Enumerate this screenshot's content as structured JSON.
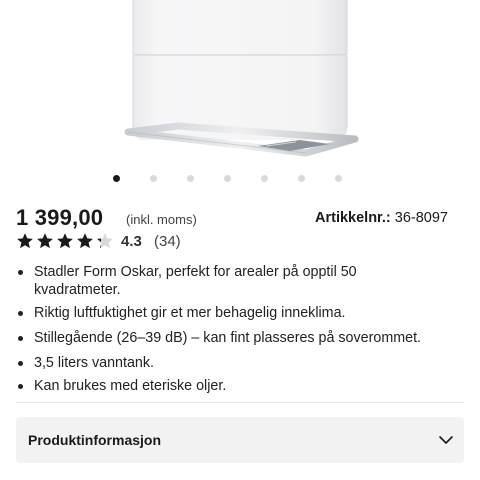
{
  "product": {
    "image_name": "Stadler Form Oskar luftfukter",
    "carousel": {
      "count": 7,
      "active_index": 0
    }
  },
  "price": {
    "amount": "1 399,00",
    "note": "(inkl. moms)"
  },
  "sku": {
    "label": "Artikkelnr.:",
    "value": "36-8097"
  },
  "rating": {
    "score": "4.3",
    "count": "(34)",
    "stars_value": 4.3,
    "stars_max": 5
  },
  "features": [
    "Stadler Form Oskar, perfekt for arealer på opptil 50 kvadratmeter.",
    "Riktig luftfuktighet gir et mer behagelig inneklima.",
    "Stillegående (26–39 dB) – kan fint plasseres på soverommet.",
    "3,5 liters vanntank.",
    "Kan brukes med eteriske oljer."
  ],
  "accordion": {
    "title": "Produktinformasjon",
    "icon": "chevron-down-icon"
  },
  "colors": {
    "text": "#222222",
    "dot_active": "#1a1a1a",
    "dot_inactive": "#d9d9d9",
    "accordion_bg": "#f2f2f2"
  }
}
